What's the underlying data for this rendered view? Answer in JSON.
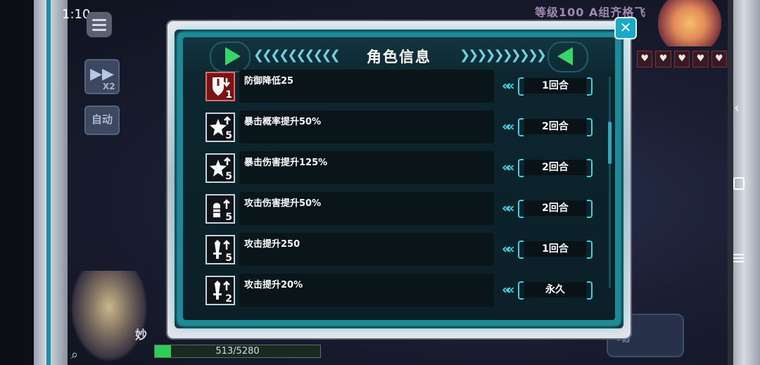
{
  "status_bar": {
    "time": "1:10"
  },
  "hud": {
    "speed_icon": "fast-forward-icon",
    "speed_label": "X2",
    "auto_label": "自动",
    "level_text": "等级100  A组齐格飞",
    "auto_bottom_label": "动",
    "player_name": "妙",
    "hp_text": "513/5280",
    "hp_fraction": 0.097
  },
  "dialog": {
    "title": "角色信息",
    "buffs": [
      {
        "icon": "defense-down-icon",
        "kind": "debuff",
        "count": "1",
        "description": "防御降低25",
        "duration": "1回合"
      },
      {
        "icon": "crit-rate-up-icon",
        "kind": "buff",
        "count": "5",
        "description": "暴击概率提升50%",
        "duration": "2回合"
      },
      {
        "icon": "crit-damage-up-icon",
        "kind": "buff",
        "count": "5",
        "description": "暴击伤害提升125%",
        "duration": "2回合"
      },
      {
        "icon": "attack-damage-up-icon",
        "kind": "buff",
        "count": "5",
        "description": "攻击伤害提升50%",
        "duration": "2回合"
      },
      {
        "icon": "attack-up-icon",
        "kind": "buff",
        "count": "5",
        "description": "攻击提升250",
        "duration": "1回合"
      },
      {
        "icon": "attack-up-icon",
        "kind": "buff",
        "count": "2",
        "description": "攻击提升20%",
        "duration": "永久"
      }
    ]
  },
  "colors": {
    "accent": "#3fd0df",
    "panel": "#0b1f27",
    "arrow_green": "#37d66b",
    "debuff_red": "#7a1414"
  }
}
